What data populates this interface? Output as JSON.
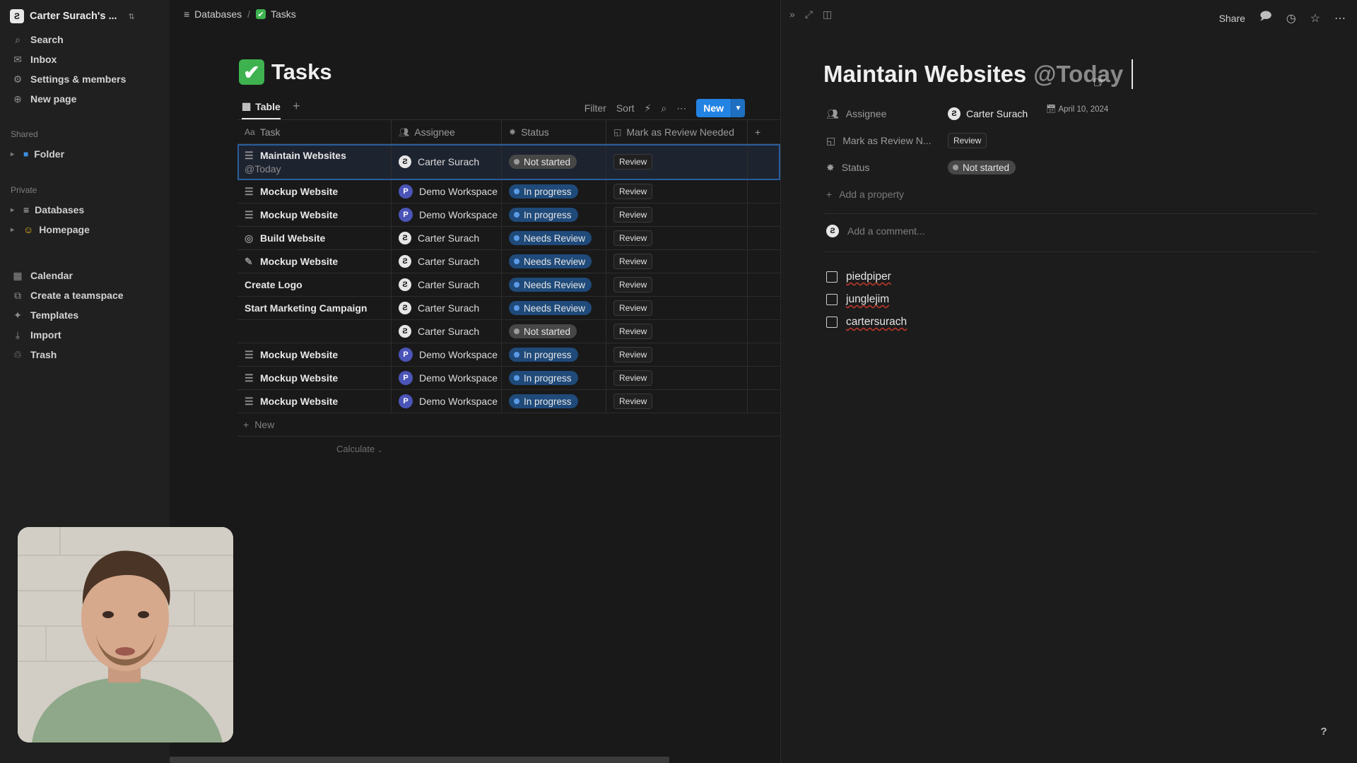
{
  "sidebar": {
    "workspace": {
      "avatar": "Ƨ",
      "name": "Carter Surach's ...",
      "switch_icon": "⇅"
    },
    "nav": [
      {
        "icon": "search-icon",
        "glyph": "⌕",
        "label": "Search"
      },
      {
        "icon": "inbox-icon",
        "glyph": "✉",
        "label": "Inbox"
      },
      {
        "icon": "gear-icon",
        "glyph": "⚙",
        "label": "Settings & members"
      },
      {
        "icon": "plus-circle-icon",
        "glyph": "⊕",
        "label": "New page"
      }
    ],
    "shared_label": "Shared",
    "shared_items": [
      {
        "icon": "folder-icon",
        "glyph": "■",
        "label": "Folder"
      }
    ],
    "private_label": "Private",
    "private_items": [
      {
        "icon": "database-icon",
        "glyph": "≡",
        "label": "Databases"
      },
      {
        "icon": "smiley-icon",
        "glyph": "☺",
        "label": "Homepage"
      }
    ],
    "bottom": [
      {
        "icon": "calendar-icon",
        "glyph": "▦",
        "label": "Calendar"
      },
      {
        "icon": "teamspace-icon",
        "glyph": "⧉",
        "label": "Create a teamspace"
      },
      {
        "icon": "templates-icon",
        "glyph": "✦",
        "label": "Templates"
      },
      {
        "icon": "import-icon",
        "glyph": "⤓",
        "label": "Import"
      },
      {
        "icon": "trash-icon",
        "glyph": "♲",
        "label": "Trash"
      }
    ]
  },
  "breadcrumb": {
    "first": "Databases",
    "second": "Tasks",
    "separator": "/"
  },
  "page": {
    "title": "Tasks",
    "emoji": "✔"
  },
  "view": {
    "tab_label": "Table",
    "add": "+",
    "filter": "Filter",
    "sort": "Sort",
    "new": "New"
  },
  "table": {
    "headers": {
      "task": "Task",
      "task_prefix": "Aa",
      "assignee": "Assignee",
      "status": "Status",
      "review": "Mark as Review Needed",
      "add": "+"
    },
    "rows": [
      {
        "task": "Maintain Websites",
        "mention": "@Today",
        "icon": "page-icon",
        "glyph": "☰",
        "assignee": "Carter Surach",
        "avatar": "carter",
        "status": "Not started",
        "status_kind": "gray",
        "button": "Review"
      },
      {
        "task": "Mockup Website",
        "icon": "page-icon",
        "glyph": "☰",
        "assignee": "Demo Workspace",
        "avatar": "P",
        "status": "In progress",
        "status_kind": "blue",
        "button": "Review"
      },
      {
        "task": "Mockup Website",
        "icon": "page-icon",
        "glyph": "☰",
        "assignee": "Demo Workspace",
        "avatar": "P",
        "status": "In progress",
        "status_kind": "blue",
        "button": "Review"
      },
      {
        "task": "Build Website",
        "icon": "globe-icon",
        "glyph": "◎",
        "assignee": "Carter Surach",
        "avatar": "carter",
        "status": "Needs Review",
        "status_kind": "blue",
        "button": "Review"
      },
      {
        "task": "Mockup Website",
        "icon": "pencil-icon",
        "glyph": "✎",
        "assignee": "Carter Surach",
        "avatar": "carter",
        "status": "Needs Review",
        "status_kind": "blue",
        "button": "Review"
      },
      {
        "task": "Create Logo",
        "icon": "",
        "glyph": "",
        "assignee": "Carter Surach",
        "avatar": "carter",
        "status": "Needs Review",
        "status_kind": "blue",
        "button": "Review"
      },
      {
        "task": "Start Marketing Campaign",
        "icon": "",
        "glyph": "",
        "assignee": "Carter Surach",
        "avatar": "carter",
        "status": "Needs Review",
        "status_kind": "blue",
        "button": "Review"
      },
      {
        "task": "",
        "icon": "",
        "glyph": "",
        "assignee": "Carter Surach",
        "avatar": "carter",
        "status": "Not started",
        "status_kind": "gray",
        "button": "Review"
      },
      {
        "task": "Mockup Website",
        "icon": "page-icon",
        "glyph": "☰",
        "assignee": "Demo Workspace",
        "avatar": "P",
        "status": "In progress",
        "status_kind": "blue",
        "button": "Review"
      },
      {
        "task": "Mockup Website",
        "icon": "page-icon",
        "glyph": "☰",
        "assignee": "Demo Workspace",
        "avatar": "P",
        "status": "In progress",
        "status_kind": "blue",
        "button": "Review"
      },
      {
        "task": "Mockup Website",
        "icon": "page-icon",
        "glyph": "☰",
        "assignee": "Demo Workspace",
        "avatar": "P",
        "status": "In progress",
        "status_kind": "blue",
        "button": "Review"
      }
    ],
    "add_row": "New",
    "calculate": "Calculate"
  },
  "colors": {
    "status_gray_bg": "#474747",
    "status_gray_dot": "#9b9b9b",
    "status_blue_bg": "#1f4a7a",
    "status_blue_dot": "#5b9be6",
    "accent": "#2383e2"
  },
  "peek": {
    "title": "Maintain Websites",
    "mention": "@Today",
    "share": "Share",
    "props": {
      "assignee_label": "Assignee",
      "assignee_value": "Carter Surach",
      "date": "April 10, 2024",
      "review_label": "Mark as Review N...",
      "review_button": "Review",
      "status_label": "Status",
      "status_value": "Not started"
    },
    "add_property": "Add a property",
    "comment_placeholder": "Add a comment...",
    "todos": [
      "piedpiper",
      "junglejim",
      "cartersurach"
    ],
    "help": "?"
  }
}
